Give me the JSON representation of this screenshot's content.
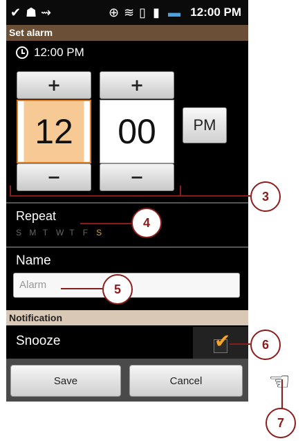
{
  "status_bar": {
    "time": "12:00 PM",
    "icons": [
      "check-icon",
      "android-icon",
      "usb-icon",
      "gps-icon",
      "wifi-icon",
      "vibrate-icon",
      "signal-icon",
      "battery-icon"
    ]
  },
  "title_bar": {
    "title": "Set alarm"
  },
  "time_display": {
    "value": "12:00 PM"
  },
  "picker": {
    "increment_label": "+",
    "decrement_label": "−",
    "hour": "12",
    "minute": "00",
    "ampm": "PM"
  },
  "repeat": {
    "label": "Repeat",
    "days": [
      {
        "letter": "S",
        "selected": false
      },
      {
        "letter": "M",
        "selected": false
      },
      {
        "letter": "T",
        "selected": false
      },
      {
        "letter": "W",
        "selected": false
      },
      {
        "letter": "T",
        "selected": false
      },
      {
        "letter": "F",
        "selected": false
      },
      {
        "letter": "S",
        "selected": true
      }
    ]
  },
  "name": {
    "label": "Name",
    "placeholder": "Alarm"
  },
  "notification": {
    "header": "Notification",
    "snooze_label": "Snooze",
    "snooze_checked": true
  },
  "buttons": {
    "save": "Save",
    "cancel": "Cancel"
  },
  "callouts": [
    "3",
    "4",
    "5",
    "6",
    "7"
  ],
  "colors": {
    "title_bar": "#6b4f36",
    "notification_header": "#d9c8b5",
    "accent": "#e07a1f",
    "callout": "#8a1c1c"
  }
}
